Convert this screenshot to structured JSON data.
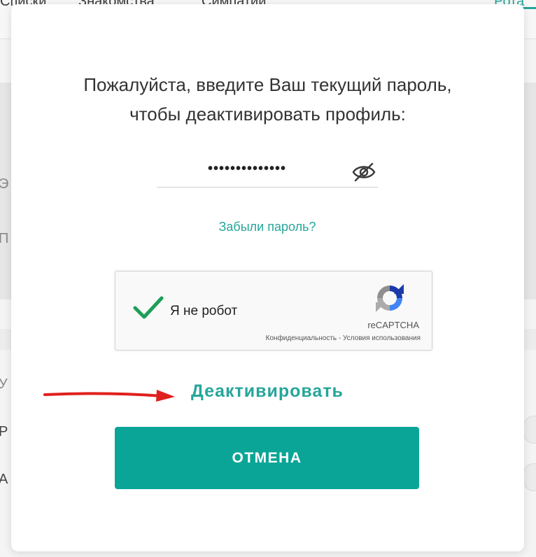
{
  "background": {
    "tabs": [
      "Списки",
      "Знакомства",
      "Симпатии",
      "Рота"
    ],
    "side_letters": [
      "Э",
      "П",
      "У",
      "Р",
      "А"
    ]
  },
  "modal": {
    "title_line1": "Пожалуйста, введите Ваш текущий пароль,",
    "title_line2": "чтобы деактивировать профиль:",
    "password_value": "••••••••••••••",
    "password_visibility_icon": "eye-slash-icon",
    "forgot_password_link": "Забыли пароль?",
    "captcha": {
      "label": "Я не робот",
      "checked": true,
      "brand": "reCAPTCHA",
      "privacy": "Конфиденциальность",
      "separator": " - ",
      "terms": "Условия использования"
    },
    "deactivate_label": "Деактивировать",
    "cancel_label": "ОТМЕНА"
  },
  "colors": {
    "accent": "#26a69a",
    "cancel_button": "#0aa597",
    "check_green": "#1e9e57",
    "annotation_red": "#e0201c"
  }
}
